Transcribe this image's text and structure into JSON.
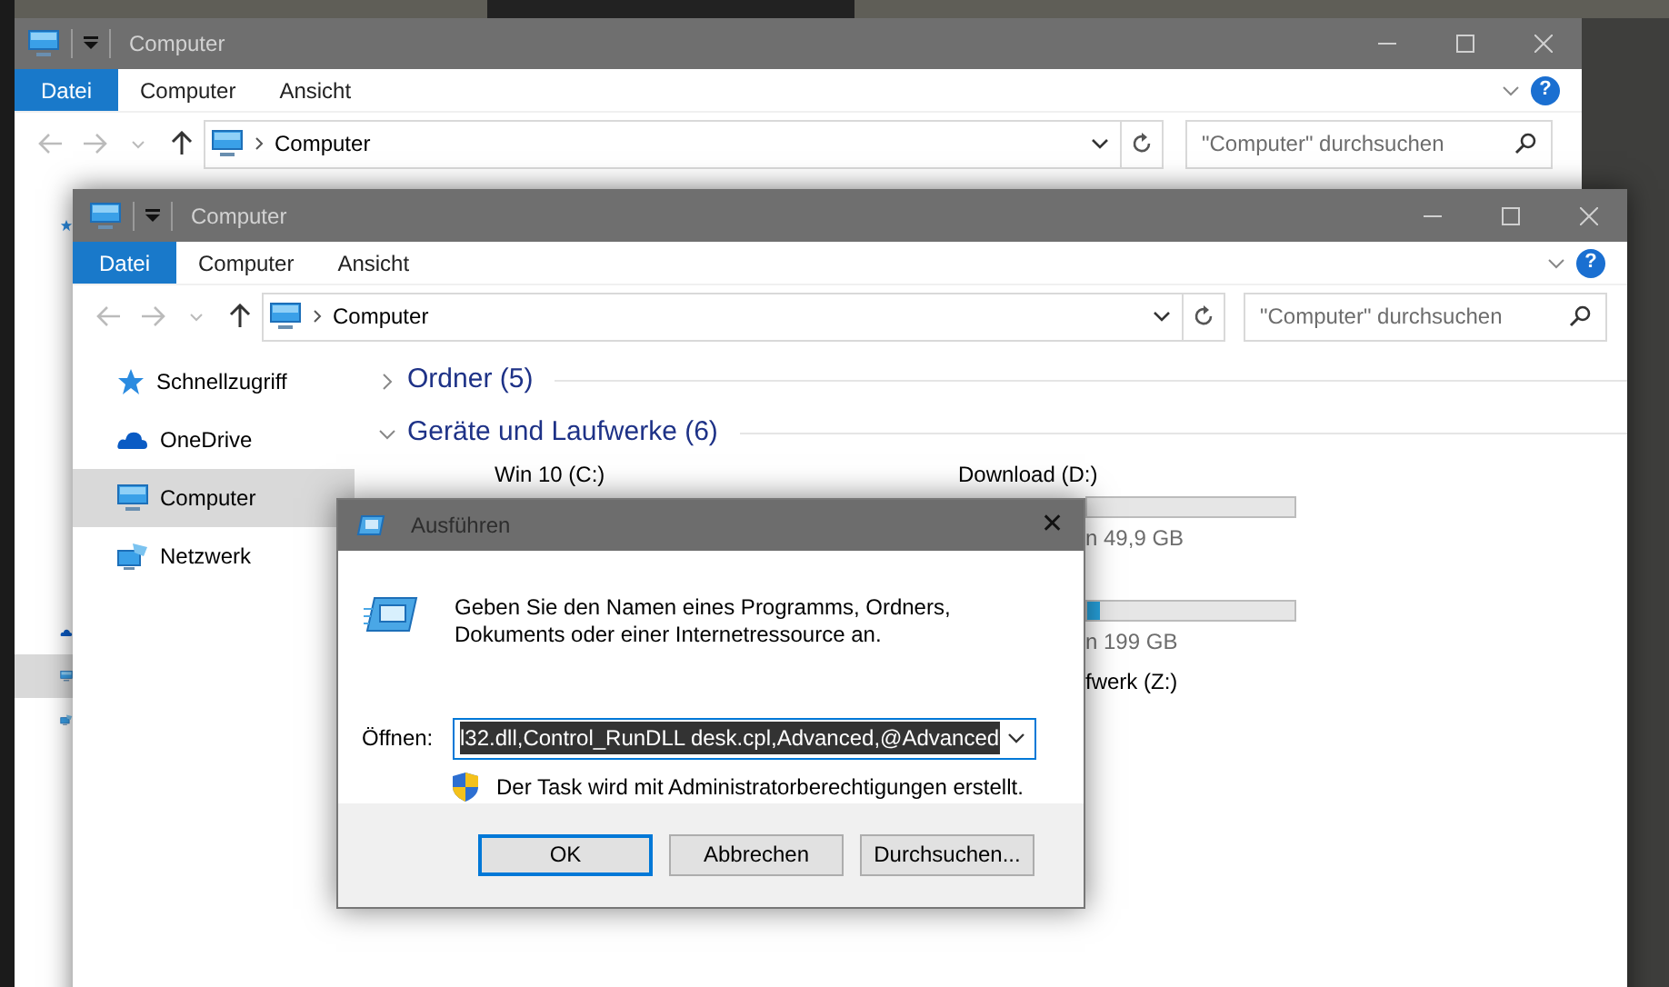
{
  "back_window": {
    "title": "Computer",
    "ribbon_tabs": [
      {
        "label": "Datei",
        "kind": "file"
      },
      {
        "label": "Computer",
        "kind": "tab"
      },
      {
        "label": "Ansicht",
        "kind": "tab"
      }
    ],
    "help": "?",
    "address": "Computer",
    "search_placeholder": "\"Computer\" durchsuchen",
    "sidebar": [
      {
        "kind": "quick",
        "selected": false
      },
      {
        "kind": "cloud",
        "selected": false
      },
      {
        "kind": "computer",
        "selected": true
      },
      {
        "kind": "network",
        "selected": false
      }
    ]
  },
  "front_window": {
    "title": "Computer",
    "ribbon_tabs": [
      {
        "label": "Datei",
        "kind": "file"
      },
      {
        "label": "Computer",
        "kind": "tab"
      },
      {
        "label": "Ansicht",
        "kind": "tab"
      }
    ],
    "help": "?",
    "address": "Computer",
    "search_placeholder": "\"Computer\" durchsuchen",
    "sidebar": [
      {
        "kind": "quick",
        "label": "Schnellzugriff",
        "selected": false
      },
      {
        "kind": "cloud",
        "label": "OneDrive",
        "selected": false
      },
      {
        "kind": "computer",
        "label": "Computer",
        "selected": true
      },
      {
        "kind": "network",
        "label": "Netzwerk",
        "selected": false
      }
    ],
    "groups": [
      {
        "label": "Ordner (5)",
        "expanded": false
      },
      {
        "label": "Geräte und Laufwerke (6)",
        "expanded": true
      }
    ],
    "drives": [
      {
        "kind": "local",
        "label": "Win 10 (C:)"
      },
      {
        "kind": "local",
        "label": "Download (D:)",
        "size": "n 49,9 GB"
      },
      {
        "kind": "local",
        "level": 0.06,
        "size": "n 199 GB"
      },
      {
        "kind": "network",
        "label": "fwerk (Z:)"
      }
    ]
  },
  "dialog": {
    "title": "Ausführen",
    "close": "✕",
    "prompt": "Geben Sie den Namen eines Programms, Ordners, Dokuments oder einer Internetressource an.",
    "open_label": "Öffnen:",
    "command": {
      "value": "l32.dll,Control_RunDLL desk.cpl,Advanced,@Advanced",
      "selected": true
    },
    "note": "Der Task wird mit Administratorberechtigungen erstellt.",
    "buttons": [
      {
        "label": "OK",
        "default": true
      },
      {
        "label": "Abbrechen",
        "default": false
      },
      {
        "label": "Durchsuchen...",
        "default": false
      }
    ]
  }
}
